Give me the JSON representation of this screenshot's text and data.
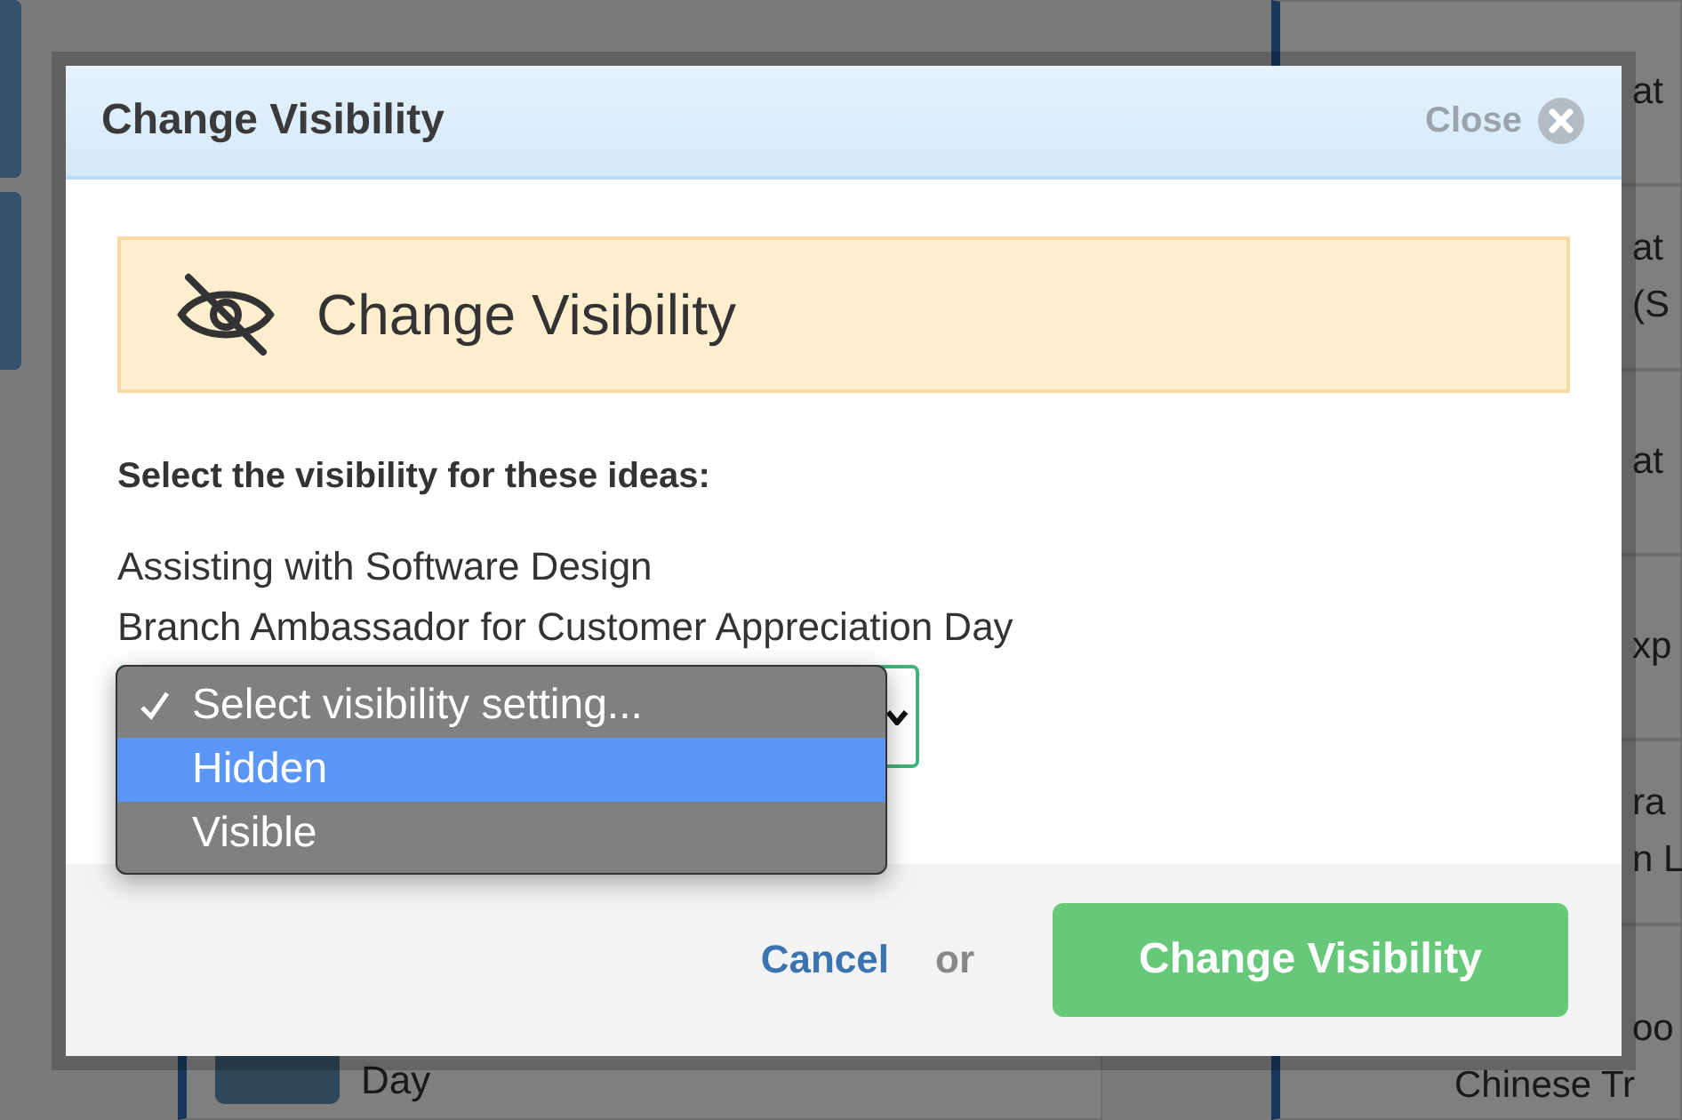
{
  "background": {
    "left_cards": [
      {
        "title": "Day"
      }
    ],
    "right_cards": [
      {
        "lines": [
          {
            "text": "at",
            "kind": "fragment"
          }
        ]
      },
      {
        "lines": [
          {
            "text": "at",
            "kind": "fragment"
          },
          {
            "text": "(S",
            "kind": "fragment"
          }
        ]
      },
      {
        "lines": [
          {
            "text": "at",
            "kind": "fragment"
          }
        ]
      },
      {
        "lines": [
          {
            "text": "xp",
            "kind": "fragment"
          }
        ]
      },
      {
        "lines": [
          {
            "text": "ra",
            "kind": "fragment"
          },
          {
            "text": "n L",
            "kind": "fragment"
          }
        ]
      },
      {
        "lines": [
          {
            "text": "oo",
            "kind": "fragment"
          },
          {
            "text": "Chinese Tr",
            "kind": "full"
          }
        ]
      }
    ]
  },
  "dialog": {
    "title": "Change Visibility",
    "close_label": "Close",
    "notice": {
      "title": "Change Visibility"
    },
    "prompt": "Select the visibility for these ideas:",
    "ideas": [
      "Assisting with Software Design",
      "Branch Ambassador for Customer Appreciation Day"
    ],
    "select": {
      "options": [
        {
          "label": "Select visibility setting...",
          "selected": true,
          "highlighted": false
        },
        {
          "label": "Hidden",
          "selected": false,
          "highlighted": true
        },
        {
          "label": "Visible",
          "selected": false,
          "highlighted": false
        }
      ]
    },
    "cancel_label": "Cancel",
    "or_label": "or",
    "submit_label": "Change Visibility"
  }
}
